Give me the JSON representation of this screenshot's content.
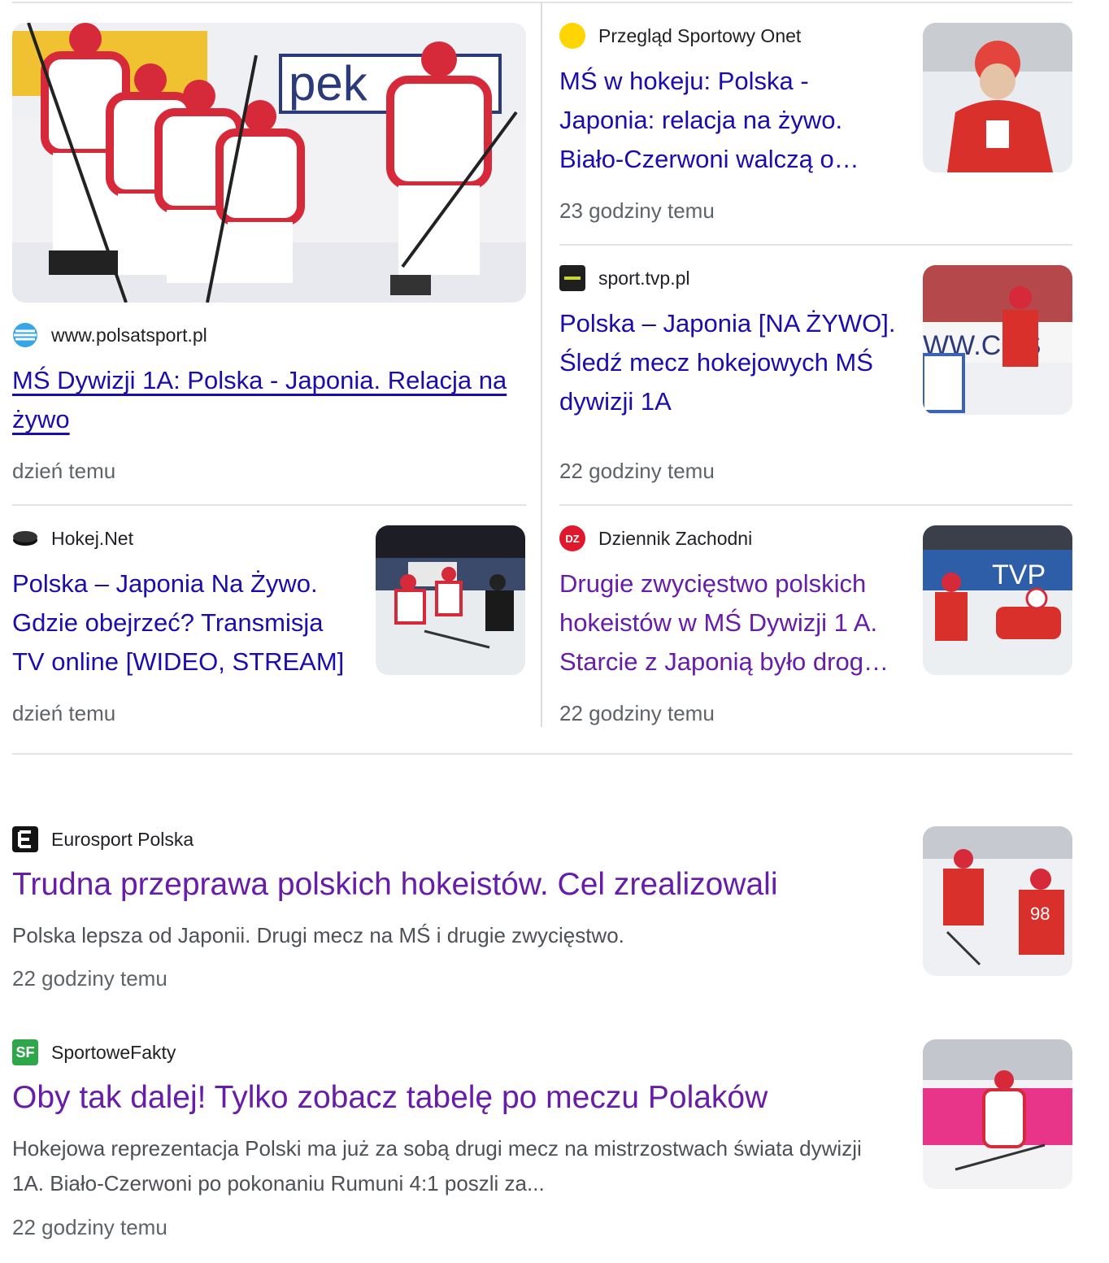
{
  "cards": {
    "polsat": {
      "source": "www.polsatsport.pl",
      "title": "MŚ Dywizji 1A: Polska - Japonia. Relacja na żywo",
      "time": "dzień temu"
    },
    "przeglad": {
      "source": "Przegląd Sportowy Onet",
      "title": "MŚ w hokeju: Polska - Japonia: relacja na żywo. Biało-Czerwoni walczą o…",
      "time": "23 godziny temu"
    },
    "tvp": {
      "source": "sport.tvp.pl",
      "title": "Polska – Japonia [NA ŻYWO]. Śledź mecz hokejowych MŚ dywizji 1A",
      "time": "22 godziny temu"
    },
    "hokej": {
      "source": "Hokej.Net",
      "title": "Polska – Japonia Na Żywo. Gdzie obejrzeć? Transmisja TV online [WIDEO, STREAM]",
      "time": "dzień temu"
    },
    "dziennik": {
      "source": "Dziennik Zachodni",
      "fav_text": "DZ",
      "title": "Drugie zwycięstwo polskich hokeistów w MŚ Dywizji 1 A. Starcie z Japonią było drog…",
      "time": "22 godziny temu"
    }
  },
  "results": {
    "eurosport": {
      "source": "Eurosport Polska",
      "title": "Trudna przeprawa polskich hokeistów. Cel zrealizowali",
      "snippet": "Polska lepsza od Japonii. Drugi mecz na MŚ i drugie zwycięstwo.",
      "time": "22 godziny temu"
    },
    "sportowefakty": {
      "source": "SportoweFakty",
      "fav_text": "SF",
      "title": "Oby tak dalej! Tylko zobacz tabelę po meczu Polaków",
      "snippet": "Hokejowa reprezentacja Polski ma już za sobą drugi mecz na mistrzostwach świata dywizji 1A. Biało-Czerwoni po pokonaniu Rumuni 4:1 poszli za...",
      "time": "22 godziny temu"
    }
  },
  "colors": {
    "link": "#1a0dab",
    "visited": "#681da8",
    "meta": "#5f6368",
    "divider": "#e3e3e3"
  }
}
